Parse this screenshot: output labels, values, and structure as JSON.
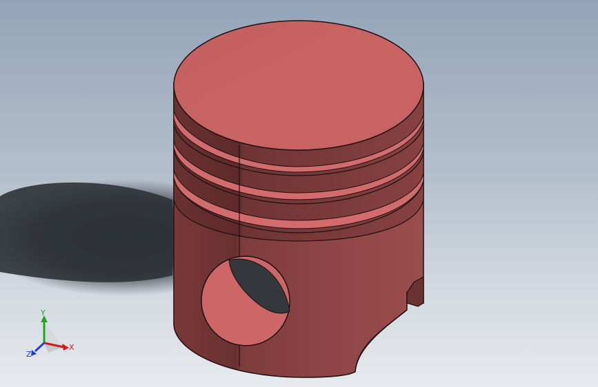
{
  "triad": {
    "x_label": "X",
    "y_label": "Y",
    "z_label": "Z"
  },
  "colors": {
    "background_top": "#94a4b8",
    "background_bottom": "#e7eaee",
    "piston_top": "#c96464",
    "piston_body": "#8c4343",
    "axis_x": "#d11a1a",
    "axis_y": "#1ca71c",
    "axis_z": "#1b3fd1"
  }
}
